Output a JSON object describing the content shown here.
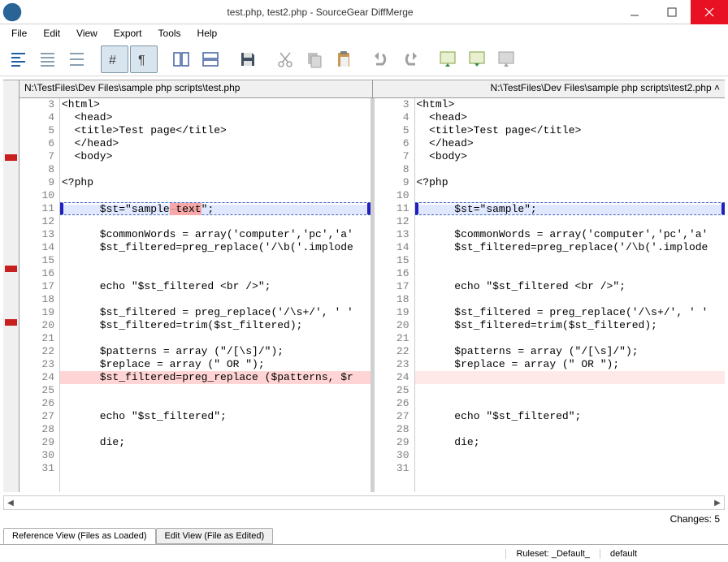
{
  "window": {
    "title": "test.php, test2.php - SourceGear DiffMerge"
  },
  "menubar": {
    "items": [
      {
        "label": "File"
      },
      {
        "label": "Edit"
      },
      {
        "label": "View"
      },
      {
        "label": "Export"
      },
      {
        "label": "Tools"
      },
      {
        "label": "Help"
      }
    ]
  },
  "panes": {
    "left": {
      "path": "N:\\TestFiles\\Dev Files\\sample php scripts\\test.php",
      "lines": [
        {
          "n": 3,
          "t": "<html>"
        },
        {
          "n": 4,
          "t": "  <head>"
        },
        {
          "n": 5,
          "t": "  <title>Test page</title>"
        },
        {
          "n": 6,
          "t": "  </head>"
        },
        {
          "n": 7,
          "t": "  <body>"
        },
        {
          "n": 8,
          "t": ""
        },
        {
          "n": 9,
          "t": "<?php"
        },
        {
          "n": 10,
          "t": ""
        },
        {
          "n": 11,
          "t": "      $st=\"sample text\";",
          "hl": "blue",
          "word": " text"
        },
        {
          "n": 12,
          "t": ""
        },
        {
          "n": 13,
          "t": "      $commonWords = array('computer','pc','a'"
        },
        {
          "n": 14,
          "t": "      $st_filtered=preg_replace('/\\b('.implode"
        },
        {
          "n": 15,
          "t": ""
        },
        {
          "n": 16,
          "t": ""
        },
        {
          "n": 17,
          "t": "      echo \"$st_filtered <br />\";"
        },
        {
          "n": 18,
          "t": ""
        },
        {
          "n": 19,
          "t": "      $st_filtered = preg_replace('/\\s+/', ' '"
        },
        {
          "n": 20,
          "t": "      $st_filtered=trim($st_filtered);"
        },
        {
          "n": 21,
          "t": ""
        },
        {
          "n": 22,
          "t": "      $patterns = array (\"/[\\s]/\");"
        },
        {
          "n": 23,
          "t": "      $replace = array (\" OR \");"
        },
        {
          "n": 24,
          "t": "      $st_filtered=preg_replace ($patterns, $r",
          "hl": "red"
        },
        {
          "n": 25,
          "t": ""
        },
        {
          "n": 26,
          "t": ""
        },
        {
          "n": 27,
          "t": "      echo \"$st_filtered\";"
        },
        {
          "n": 28,
          "t": ""
        },
        {
          "n": 29,
          "t": "      die;"
        },
        {
          "n": 30,
          "t": ""
        },
        {
          "n": 31,
          "t": ""
        }
      ]
    },
    "right": {
      "path": "N:\\TestFiles\\Dev Files\\sample php scripts\\test2.php",
      "lines": [
        {
          "n": 3,
          "t": "<html>"
        },
        {
          "n": 4,
          "t": "  <head>"
        },
        {
          "n": 5,
          "t": "  <title>Test page</title>"
        },
        {
          "n": 6,
          "t": "  </head>"
        },
        {
          "n": 7,
          "t": "  <body>"
        },
        {
          "n": 8,
          "t": ""
        },
        {
          "n": 9,
          "t": "<?php"
        },
        {
          "n": 10,
          "t": ""
        },
        {
          "n": 11,
          "t": "      $st=\"sample\";",
          "hl": "blue"
        },
        {
          "n": 12,
          "t": ""
        },
        {
          "n": 13,
          "t": "      $commonWords = array('computer','pc','a'"
        },
        {
          "n": 14,
          "t": "      $st_filtered=preg_replace('/\\b('.implode"
        },
        {
          "n": 15,
          "t": ""
        },
        {
          "n": 16,
          "t": ""
        },
        {
          "n": 17,
          "t": "      echo \"$st_filtered <br />\";"
        },
        {
          "n": 18,
          "t": ""
        },
        {
          "n": 19,
          "t": "      $st_filtered = preg_replace('/\\s+/', ' '"
        },
        {
          "n": 20,
          "t": "      $st_filtered=trim($st_filtered);"
        },
        {
          "n": 21,
          "t": ""
        },
        {
          "n": 22,
          "t": "      $patterns = array (\"/[\\s]/\");"
        },
        {
          "n": 23,
          "t": "      $replace = array (\" OR \");"
        },
        {
          "n": 24,
          "t": "",
          "hl": "redsoft"
        },
        {
          "n": 25,
          "t": ""
        },
        {
          "n": 26,
          "t": ""
        },
        {
          "n": 27,
          "t": "      echo \"$st_filtered\";"
        },
        {
          "n": 28,
          "t": ""
        },
        {
          "n": 29,
          "t": "      die;"
        },
        {
          "n": 30,
          "t": ""
        },
        {
          "n": 31,
          "t": ""
        }
      ]
    }
  },
  "markers": [
    18,
    45,
    58
  ],
  "changes": {
    "label": "Changes:",
    "count": 5
  },
  "tabs": [
    {
      "label": "Reference View (Files as Loaded)",
      "active": true
    },
    {
      "label": "Edit View (File as Edited)",
      "active": false
    }
  ],
  "status": {
    "ruleset_label": "Ruleset:",
    "ruleset_value": "_Default_",
    "mode": "default"
  }
}
